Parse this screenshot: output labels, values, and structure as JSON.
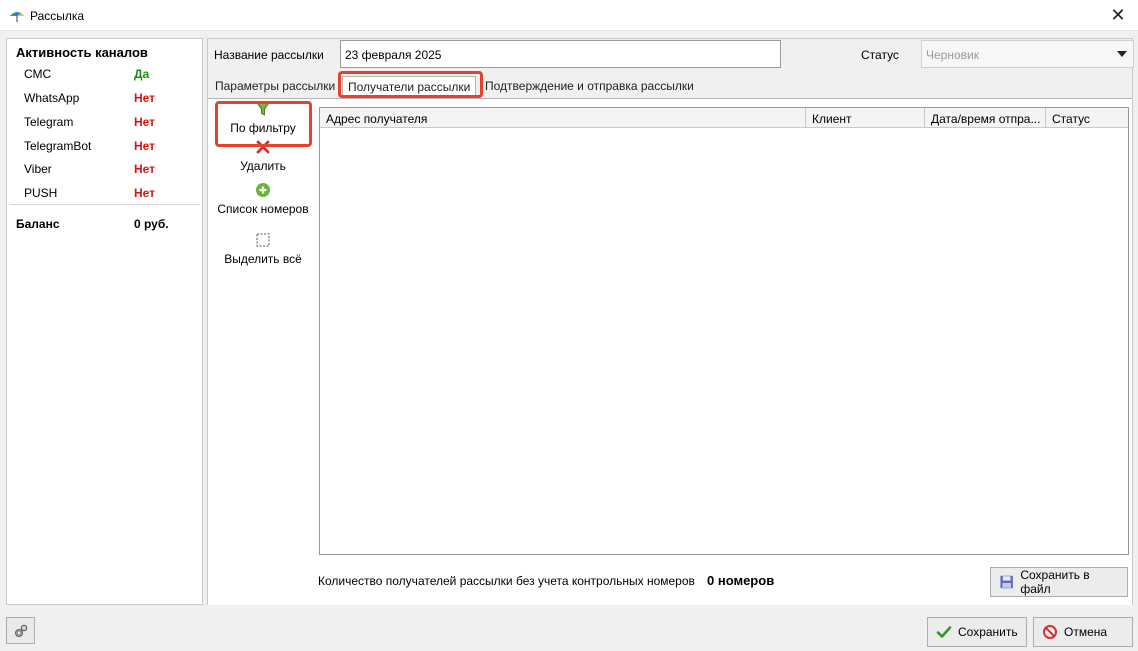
{
  "window": {
    "title": "Рассылка",
    "close_glyph": "✕"
  },
  "channels": {
    "heading": "Активность каналов",
    "items": [
      {
        "name": "СМС",
        "value": "Да",
        "active": true
      },
      {
        "name": "WhatsApp",
        "value": "Нет",
        "active": false
      },
      {
        "name": "Telegram",
        "value": "Нет",
        "active": false
      },
      {
        "name": "TelegramBot",
        "value": "Нет",
        "active": false
      },
      {
        "name": "Viber",
        "value": "Нет",
        "active": false
      },
      {
        "name": "PUSH",
        "value": "Нет",
        "active": false
      }
    ],
    "balance_label": "Баланс",
    "balance_value": "0 руб."
  },
  "form": {
    "name_label": "Название рассылки",
    "name_value": "23 февраля 2025",
    "status_label": "Статус",
    "status_value": "Черновик"
  },
  "tabs": [
    {
      "label": "Параметры рассылки",
      "active": false
    },
    {
      "label": "Получатели рассылки",
      "active": true
    },
    {
      "label": "Подтверждение и отправка рассылки",
      "active": false
    }
  ],
  "toolbar": {
    "filter_label": "По фильтру",
    "delete_label": "Удалить",
    "numbers_label": "Список номеров",
    "select_all_label": "Выделить всё"
  },
  "grid": {
    "columns": [
      "Адрес получателя",
      "Клиент",
      "Дата/время отпра...",
      "Статус"
    ],
    "rows": []
  },
  "summary": {
    "count_label": "Количество получателей рассылки без учета контрольных номеров",
    "count_value": "0 номеров",
    "save_file_label": "Сохранить в файл"
  },
  "footer": {
    "save_label": "Сохранить",
    "cancel_label": "Отмена"
  },
  "colors": {
    "yes": "#1a8a1a",
    "no": "#e01010",
    "highlight": "#e8412a"
  }
}
